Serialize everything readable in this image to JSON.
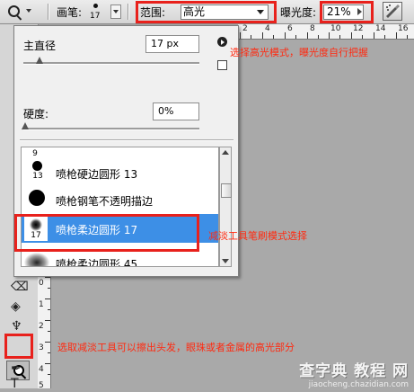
{
  "options_bar": {
    "brush_label": "画笔:",
    "brush_size": "17",
    "range_label": "范围:",
    "range_value": "高光",
    "exposure_label": "曝光度:",
    "exposure_value": "21%"
  },
  "brush_panel": {
    "master_diameter_label": "主直径",
    "master_diameter_value": "17 px",
    "hardness_label": "硬度:",
    "hardness_value": "0%",
    "brushes": [
      {
        "size": "9",
        "name": ""
      },
      {
        "size": "13",
        "name": "喷枪硬边圆形 13"
      },
      {
        "size": "",
        "name": "喷枪钢笔不透明描边"
      },
      {
        "size": "17",
        "name": "喷枪柔边圆形 17"
      },
      {
        "size": "",
        "name": "喷枪柔边圆形 45"
      }
    ]
  },
  "rulers": {
    "top_labels": [
      "2",
      "4",
      "6",
      "8",
      "10",
      "12",
      "14",
      "16"
    ],
    "left_labels": [
      "0",
      "1",
      "2",
      "3",
      "4",
      "5"
    ]
  },
  "annotations": {
    "range_note": "选择高光模式，曝光度自行把握",
    "brush_note": "减淡工具笔刷模式选择",
    "tool_note": "选取减淡工具可以擦出头发，眼珠或者金属的高光部分"
  },
  "watermark": {
    "title": "查字典 教程 网",
    "url": "jiaocheng.chazidian.com"
  },
  "colors": {
    "highlight_box": "#e8211c",
    "selected_item": "#3d8fe6",
    "annotation_text": "#ff2a10"
  }
}
